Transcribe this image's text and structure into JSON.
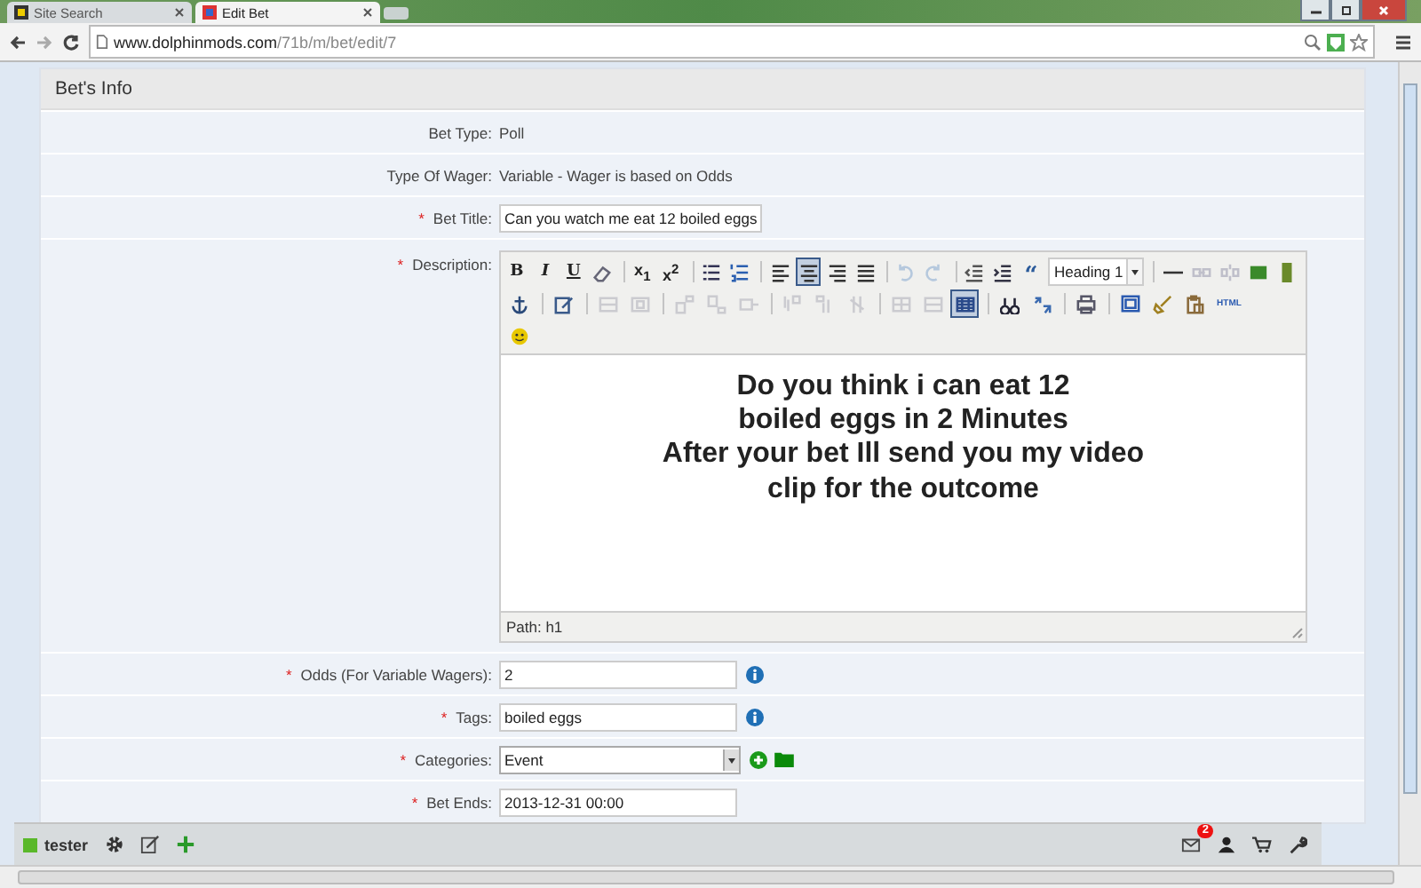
{
  "browser": {
    "tabs": [
      {
        "title": "Site Search",
        "selected": false
      },
      {
        "title": "Edit Bet",
        "selected": true
      }
    ],
    "url_domain": "www.dolphinmods.com",
    "url_path": "/71b/m/bet/edit/7"
  },
  "panel": {
    "title": "Bet's Info"
  },
  "required_mark": "*",
  "fields": [
    {
      "kind": "static",
      "label": "Bet Type:",
      "required": false,
      "value": "Poll"
    },
    {
      "kind": "static",
      "label": "Type Of Wager:",
      "required": false,
      "value": "Variable - Wager is based on Odds"
    },
    {
      "kind": "input",
      "label": "Bet Title:",
      "required": true,
      "value": "Can you watch me eat 12 boiled eggs",
      "info": false
    },
    {
      "kind": "editor",
      "label": "Description:",
      "required": true
    },
    {
      "kind": "input",
      "label": "Odds (For Variable Wagers):",
      "required": true,
      "value": "2",
      "info": true
    },
    {
      "kind": "input",
      "label": "Tags:",
      "required": true,
      "value": "boiled eggs",
      "info": true
    },
    {
      "kind": "select",
      "label": "Categories:",
      "required": true,
      "value": "Event"
    },
    {
      "kind": "input",
      "label": "Bet Ends:",
      "required": true,
      "value": "2013-12-31 00:00",
      "info": false
    }
  ],
  "editor": {
    "toolbar": [
      [
        [
          {
            "kind": "bold",
            "label": "B",
            "active": false,
            "disabled": false
          },
          {
            "kind": "italic",
            "label": "I",
            "active": false,
            "disabled": false
          },
          {
            "kind": "underline",
            "label": "U",
            "active": false,
            "disabled": false
          },
          {
            "kind": "eraser",
            "active": false,
            "disabled": false
          }
        ],
        [
          {
            "kind": "subscript",
            "label": "x$_{1}$",
            "active": false,
            "disabled": false
          },
          {
            "kind": "superscript",
            "label": "x$^{2}$",
            "active": false,
            "disabled": false
          }
        ],
        [
          {
            "kind": "bullets",
            "active": false,
            "disabled": false
          },
          {
            "kind": "numbering",
            "active": false,
            "disabled": false
          }
        ],
        [
          {
            "kind": "alignleft",
            "active": false,
            "disabled": false
          },
          {
            "kind": "aligncenter",
            "active": true,
            "disabled": false
          },
          {
            "kind": "alignright",
            "active": false,
            "disabled": false
          },
          {
            "kind": "justify",
            "active": false,
            "disabled": false
          }
        ],
        [
          {
            "kind": "undo",
            "active": false,
            "disabled": true
          },
          {
            "kind": "redo",
            "active": false,
            "disabled": true
          }
        ],
        [
          {
            "kind": "outdent",
            "active": false,
            "disabled": false
          },
          {
            "kind": "indent",
            "active": false,
            "disabled": false
          },
          {
            "kind": "quote",
            "label": "“",
            "active": false,
            "disabled": false
          },
          {
            "kind": "format",
            "label": "Heading 1",
            "active": false,
            "disabled": false
          }
        ],
        [
          {
            "kind": "rule",
            "active": false,
            "disabled": false
          },
          {
            "kind": "link",
            "active": false,
            "disabled": true
          },
          {
            "kind": "unlink",
            "active": false,
            "disabled": true
          },
          {
            "kind": "image",
            "active": false,
            "disabled": false
          },
          {
            "kind": "media",
            "active": false,
            "disabled": false
          }
        ]
      ],
      [
        [
          {
            "kind": "anchor",
            "active": false,
            "disabled": false
          }
        ],
        [
          {
            "kind": "edit",
            "active": false,
            "disabled": false
          }
        ],
        [
          {
            "kind": "rows",
            "active": false,
            "disabled": true
          },
          {
            "kind": "cells",
            "active": false,
            "disabled": true
          }
        ],
        [
          {
            "kind": "rowbefore",
            "active": false,
            "disabled": true
          },
          {
            "kind": "rowafter",
            "active": false,
            "disabled": true
          },
          {
            "kind": "deleterow",
            "active": false,
            "disabled": true
          }
        ],
        [
          {
            "kind": "colbefore",
            "active": false,
            "disabled": true
          },
          {
            "kind": "colafter",
            "active": false,
            "disabled": true
          },
          {
            "kind": "deletecol",
            "active": false,
            "disabled": true
          }
        ],
        [
          {
            "kind": "split",
            "active": false,
            "disabled": true
          },
          {
            "kind": "merge",
            "active": false,
            "disabled": true
          },
          {
            "kind": "table",
            "active": true,
            "disabled": false
          }
        ],
        [
          {
            "kind": "find",
            "active": false,
            "disabled": false
          },
          {
            "kind": "replace",
            "active": false,
            "disabled": false
          }
        ],
        [
          {
            "kind": "print",
            "active": false,
            "disabled": false
          }
        ],
        [
          {
            "kind": "fullscreen",
            "active": false,
            "disabled": false
          },
          {
            "kind": "cleanup",
            "active": false,
            "disabled": false
          },
          {
            "kind": "paste",
            "active": false,
            "disabled": false
          },
          {
            "kind": "html",
            "label": "HTML",
            "active": false,
            "disabled": false
          }
        ]
      ],
      [
        [
          {
            "kind": "emoticon",
            "active": false,
            "disabled": false
          }
        ]
      ]
    ],
    "content_lines": [
      "Do you think i can eat 12",
      "boiled eggs in 2 Minutes",
      "After your bet Ill send you my video",
      "clip for the outcome"
    ],
    "path": "Path: h1"
  },
  "toolbar": {
    "user": "tester",
    "mail_badge": "2"
  }
}
